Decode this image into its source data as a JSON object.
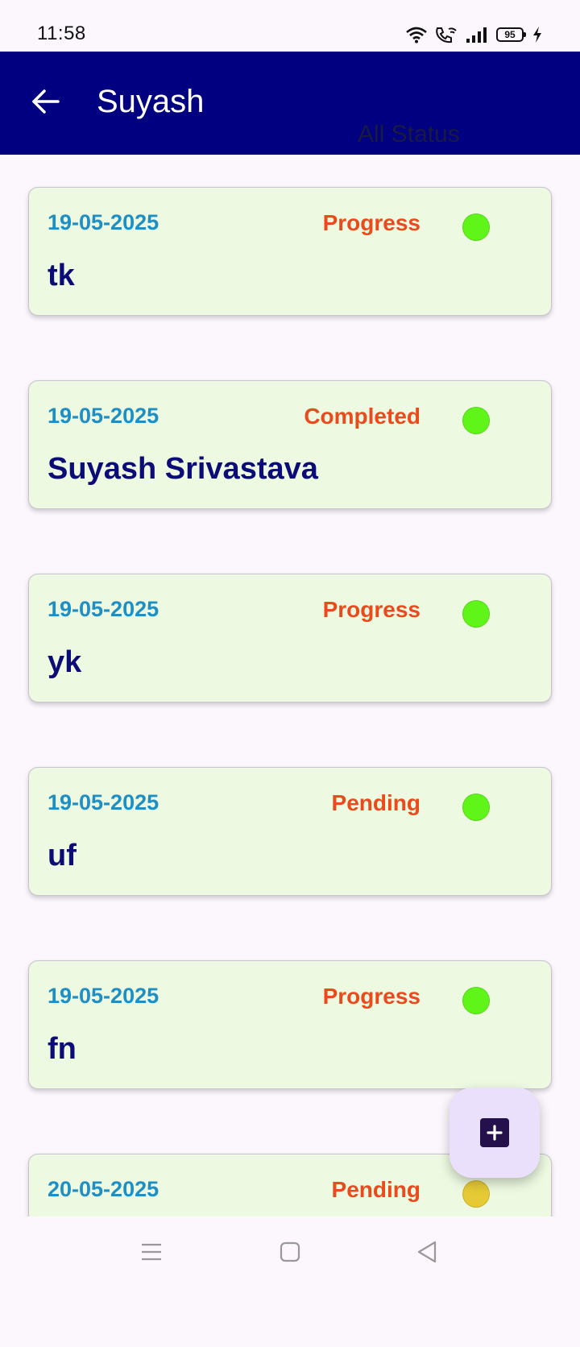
{
  "status_bar": {
    "time": "11:58",
    "battery": "95",
    "icons": [
      "wifi-icon",
      "wifi-calling-icon",
      "signal-icon",
      "battery-icon",
      "charging-icon"
    ]
  },
  "app_bar": {
    "title": "Suyash",
    "back_icon": "arrow-left-icon",
    "filter_label": "All Status",
    "background_color": "#000080"
  },
  "tasks": [
    {
      "date": "19-05-2025",
      "status": "Progress",
      "name": "tk",
      "dot_color": "#5ff519"
    },
    {
      "date": "19-05-2025",
      "status": "Completed",
      "name": "Suyash Srivastava",
      "dot_color": "#5ff519"
    },
    {
      "date": "19-05-2025",
      "status": "Progress",
      "name": "yk",
      "dot_color": "#5ff519"
    },
    {
      "date": "19-05-2025",
      "status": "Pending",
      "name": "uf",
      "dot_color": "#5ff519"
    },
    {
      "date": "19-05-2025",
      "status": "Progress",
      "name": "fn",
      "dot_color": "#5ff519"
    },
    {
      "date": "20-05-2025",
      "status": "Pending",
      "name": "",
      "dot_color": "#e5c935"
    }
  ],
  "fab": {
    "icon": "plus-icon"
  },
  "colors": {
    "date": "#1e8fc4",
    "status": "#ea4b1d",
    "name": "#0c0c78",
    "card_bg": "#edf9e1"
  },
  "nav_bar": {
    "icons": [
      "menu-icon",
      "home-icon",
      "back-triangle-icon"
    ]
  }
}
